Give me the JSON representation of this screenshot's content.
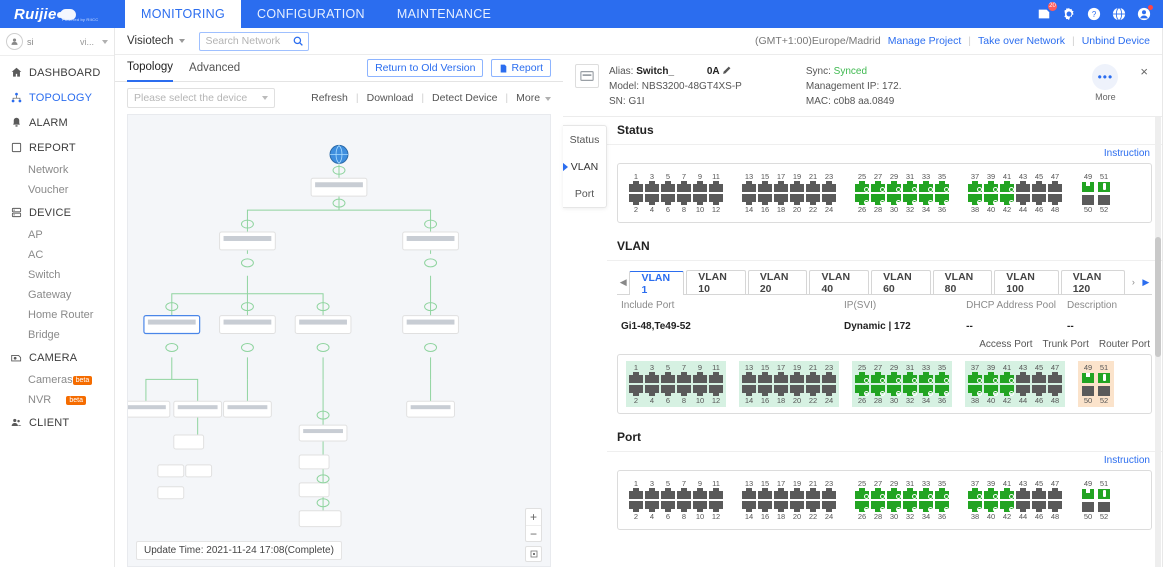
{
  "topbar": {
    "brand": "Ruijie",
    "brand_sub": "Powered by RIICC",
    "nav": [
      {
        "label": "MONITORING",
        "active": true
      },
      {
        "label": "CONFIGURATION",
        "active": false
      },
      {
        "label": "MAINTENANCE",
        "active": false
      }
    ],
    "icons": [
      "notification-icon",
      "gear-icon",
      "help-icon",
      "globe-icon",
      "account-icon"
    ],
    "notification_count": "20"
  },
  "sidebar": {
    "user": {
      "name": "si",
      "org": "vi..."
    },
    "items": [
      {
        "label": "DASHBOARD",
        "icon": "home-icon",
        "type": "main",
        "active": false
      },
      {
        "label": "TOPOLOGY",
        "icon": "topology-icon",
        "type": "main",
        "active": true
      },
      {
        "label": "ALARM",
        "icon": "alarm-icon",
        "type": "main",
        "active": false
      },
      {
        "label": "REPORT",
        "icon": "report-icon",
        "type": "main",
        "active": false
      },
      {
        "label": "Network",
        "type": "sub"
      },
      {
        "label": "Voucher",
        "type": "sub"
      },
      {
        "label": "DEVICE",
        "icon": "device-icon",
        "type": "main",
        "active": false
      },
      {
        "label": "AP",
        "type": "sub"
      },
      {
        "label": "AC",
        "type": "sub"
      },
      {
        "label": "Switch",
        "type": "sub"
      },
      {
        "label": "Gateway",
        "type": "sub"
      },
      {
        "label": "Home Router",
        "type": "sub"
      },
      {
        "label": "Bridge",
        "type": "sub"
      },
      {
        "label": "CAMERA",
        "icon": "camera-icon",
        "type": "main",
        "active": false
      },
      {
        "label": "Cameras",
        "type": "sub",
        "badge": "beta"
      },
      {
        "label": "NVR",
        "type": "sub",
        "badge": "beta"
      },
      {
        "label": "CLIENT",
        "icon": "client-icon",
        "type": "main",
        "active": false
      }
    ]
  },
  "subbar": {
    "project": "Visiotech",
    "search_placeholder": "Search Network",
    "timezone": "(GMT+1:00)Europe/Madrid",
    "links": [
      "Manage Project",
      "Take over Network",
      "Unbind Device"
    ]
  },
  "topology": {
    "tabs": [
      {
        "label": "Topology",
        "active": true
      },
      {
        "label": "Advanced",
        "active": false
      }
    ],
    "return_old_version": "Return to Old Version",
    "report": "Report",
    "device_select_placeholder": "Please select the device",
    "actions": [
      "Refresh",
      "Download",
      "Detect Device",
      "More"
    ],
    "update_time": "Update Time: 2021-11-24 17:08(Complete)",
    "zoom_in": "+",
    "zoom_out": "−"
  },
  "device": {
    "alias_label": "Alias:",
    "alias_value": "Switch_",
    "alias_suffix": "0A",
    "model_label": "Model:",
    "model_value": "NBS3200-48GT4XS-P",
    "sn_label": "SN:",
    "sn_value": "G1I",
    "sync_label": "Sync:",
    "sync_value": "Synced",
    "mgmt_label": "Management IP:",
    "mgmt_value": "172.",
    "mac_label": "MAC:",
    "mac_value": "c0b8      aa.0849",
    "more_label": "More",
    "close": "×"
  },
  "side_tabs": [
    {
      "label": "Status",
      "active": false
    },
    {
      "label": "VLAN",
      "active": true
    },
    {
      "label": "Port",
      "active": false
    }
  ],
  "sections": {
    "status_title": "Status",
    "vlan_title": "VLAN",
    "port_title": "Port",
    "instruction": "Instruction"
  },
  "vlan": {
    "tabs": [
      "VLAN 1",
      "VLAN 10",
      "VLAN 20",
      "VLAN 40",
      "VLAN 60",
      "VLAN 80",
      "VLAN 100",
      "VLAN 120"
    ],
    "active_tab": "VLAN 1",
    "headers": [
      "Include Port",
      "IP(SVI)",
      "DHCP Address Pool",
      "Description"
    ],
    "values": [
      "Gi1-48,Te49-52",
      "Dynamic | 172",
      "--",
      "--"
    ],
    "legend": [
      {
        "label": "Access Port",
        "color": "#d6f1e2"
      },
      {
        "label": "Trunk Port",
        "color": "#fbe3cb"
      },
      {
        "label": "Router Port",
        "color": "#d3e4fb"
      }
    ]
  },
  "ports": {
    "count": 52,
    "groups": [
      {
        "start": 1,
        "end": 12
      },
      {
        "start": 13,
        "end": 24
      },
      {
        "start": 25,
        "end": 36
      },
      {
        "start": 37,
        "end": 48
      },
      {
        "start": 49,
        "end": 52,
        "sfp": true
      }
    ],
    "status_active": [
      25,
      26,
      27,
      28,
      29,
      30,
      31,
      32,
      33,
      34,
      35,
      36,
      37,
      38,
      39,
      40,
      41,
      42,
      49,
      51
    ],
    "vlan_access_groups": [
      0,
      1,
      2,
      3
    ],
    "vlan_trunk_groups": [
      4
    ]
  }
}
